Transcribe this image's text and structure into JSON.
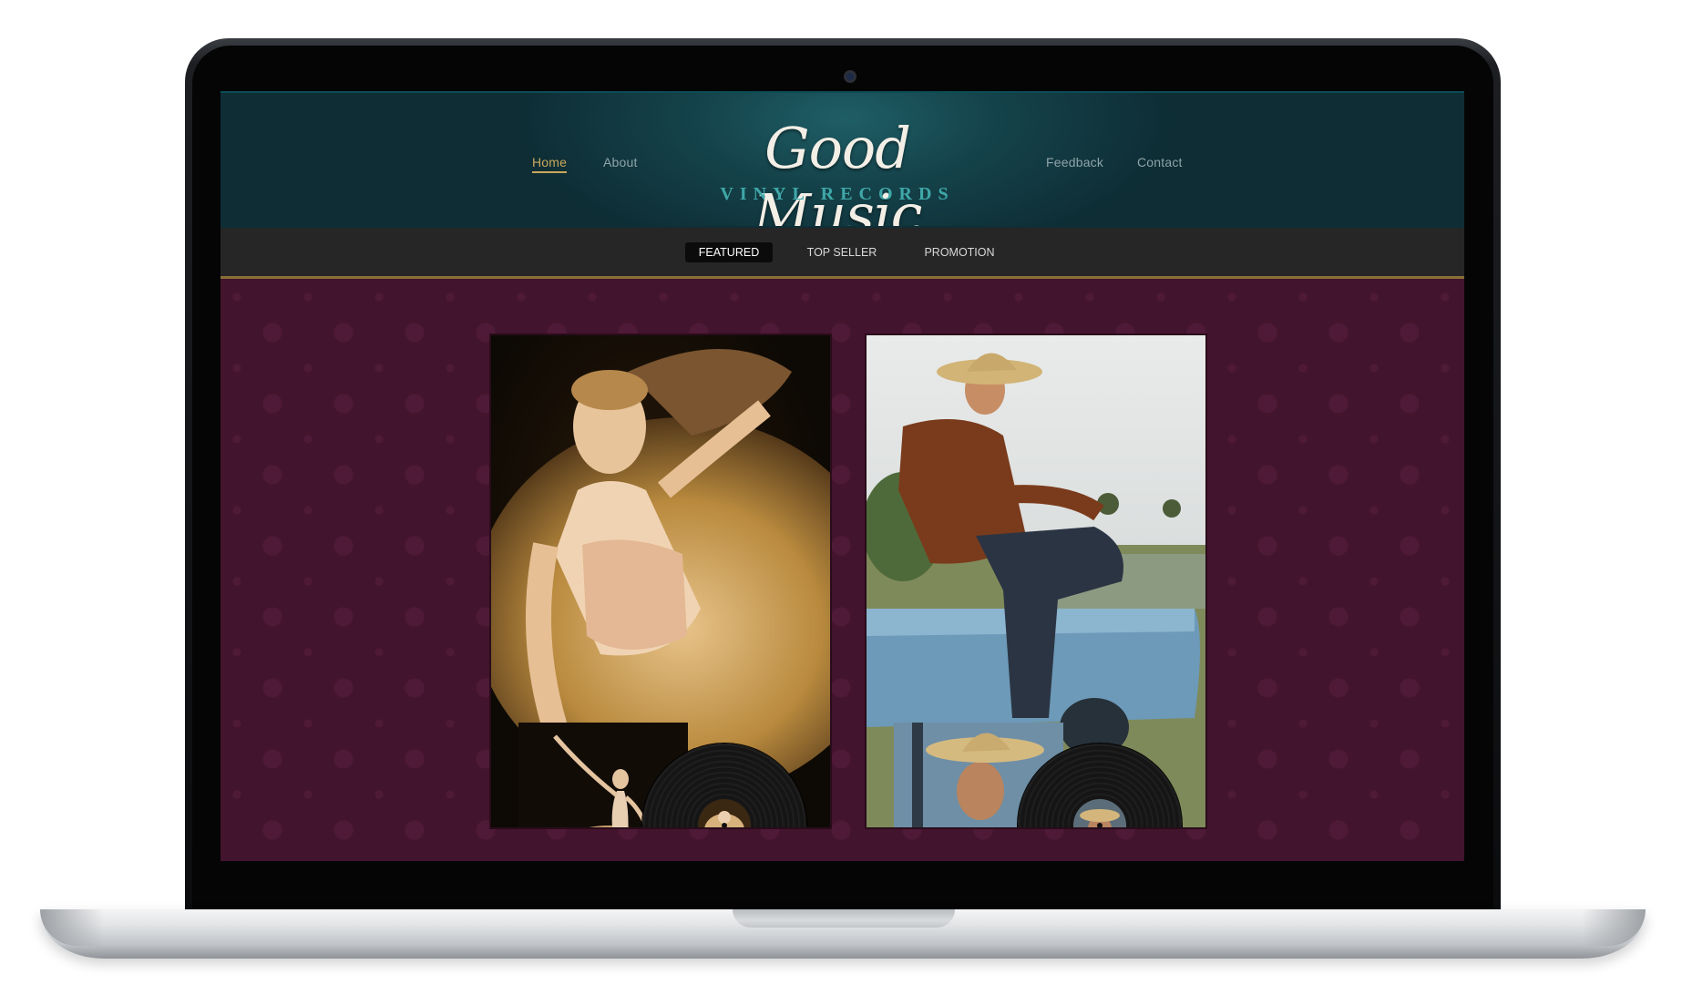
{
  "site": {
    "logo_title": "Good Music",
    "logo_subtitle": "VINYL RECORDS"
  },
  "nav": {
    "home": "Home",
    "about": "About",
    "feedback": "Feedback",
    "contact": "Contact",
    "active": "Home"
  },
  "tabs": {
    "featured": "FEATURED",
    "top_seller": "TOP SELLER",
    "promotion": "PROMOTION",
    "selected": "FEATURED"
  },
  "albums": [
    {
      "image": "ballerina-photo"
    },
    {
      "image": "cowboy-photo"
    }
  ],
  "colors": {
    "header": "#0e2d35",
    "accent": "#c9a85a",
    "teal_text": "#3fa7a8",
    "background": "#43142d"
  }
}
